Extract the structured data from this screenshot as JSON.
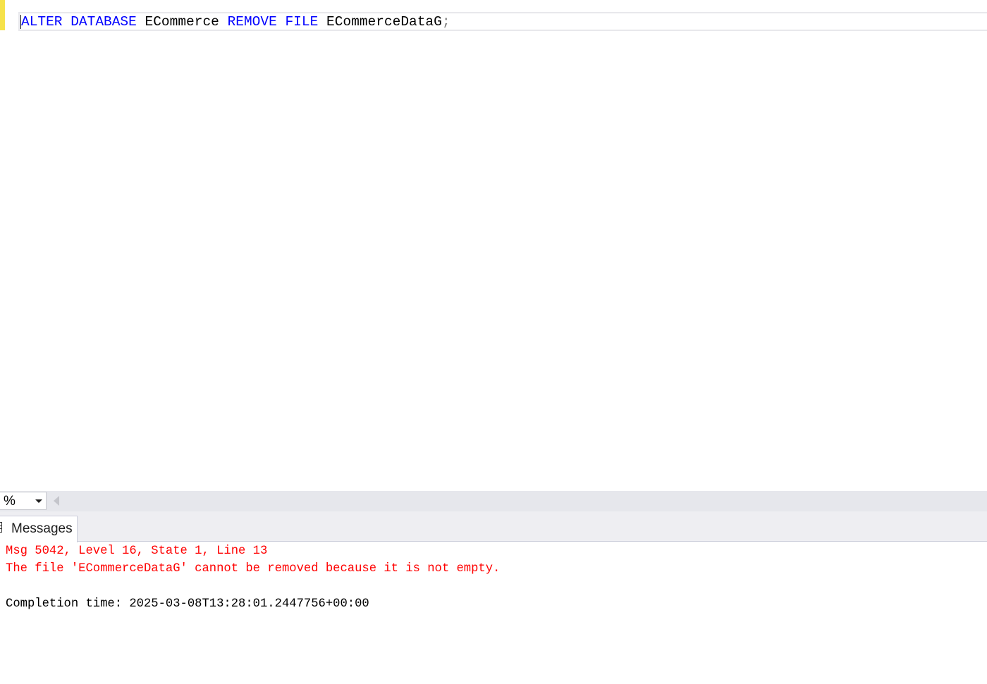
{
  "editor": {
    "code": {
      "kw1": "ALTER DATABASE",
      "ident1": "ECommerce",
      "kw2": "REMOVE FILE",
      "ident2": "ECommerceDataG",
      "terminator": ";"
    }
  },
  "zoom": {
    "value": "%"
  },
  "results": {
    "tabs": [
      {
        "label": "Messages",
        "icon": "messages-icon"
      }
    ]
  },
  "messages": {
    "error_header": "Msg 5042, Level 16, State 1, Line 13",
    "error_text": "The file 'ECommerceDataG' cannot be removed because it is not empty.",
    "completion": "Completion time: 2025-03-08T13:28:01.2447756+00:00"
  },
  "colors": {
    "keyword": "#0000ff",
    "error": "#ff0000",
    "change_bar": "#f6e24a"
  }
}
